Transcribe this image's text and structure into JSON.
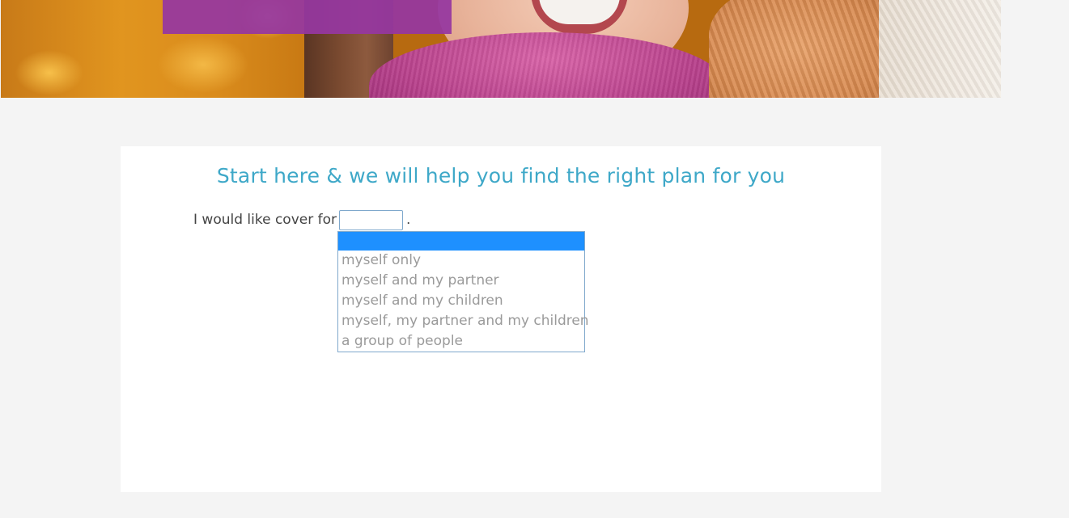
{
  "hero": {
    "image": "smiling-woman-autumn-scarf-photo"
  },
  "form": {
    "heading": "Start here & we will help you find the right plan for you",
    "cover_label": "I would like cover for",
    "cover_value": "",
    "period": ".",
    "options": [
      "",
      "myself only",
      "myself and my partner",
      "myself and my children",
      "myself, my partner and my children",
      "a group of people"
    ]
  },
  "colors": {
    "heading": "#3ea8c8",
    "highlight": "#1e90ff",
    "banner_overlay": "#9637a0",
    "option_text": "#9a9a9a"
  }
}
